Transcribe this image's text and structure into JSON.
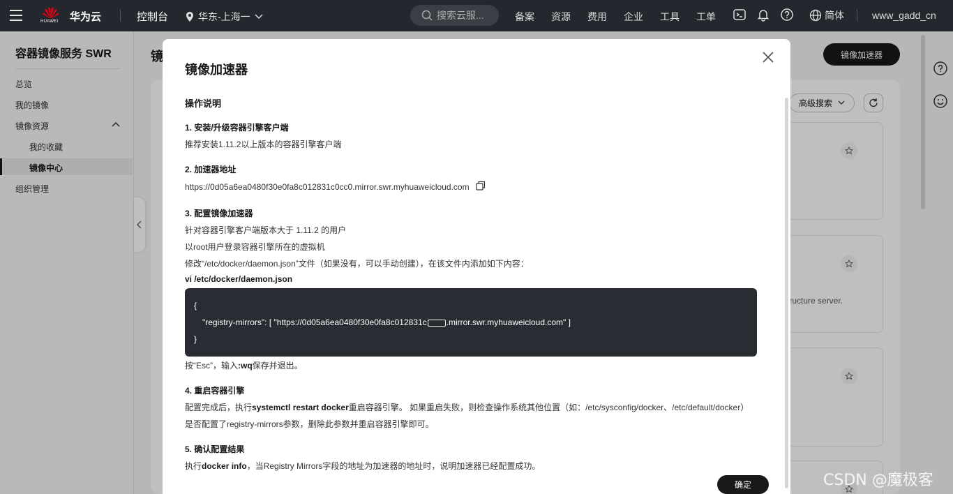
{
  "topbar": {
    "logo_text": "HUAWEI",
    "brand": "华为云",
    "console": "控制台",
    "region": "华东-上海一",
    "search_placeholder": "搜索云服...",
    "links": [
      "备案",
      "资源",
      "费用",
      "企业",
      "工具",
      "工单"
    ],
    "language": "简体",
    "user": "www_gadd_cn"
  },
  "sidebar": {
    "title": "容器镜像服务 SWR",
    "items": [
      {
        "label": "总览"
      },
      {
        "label": "我的镜像"
      },
      {
        "label": "镜像资源"
      },
      {
        "label": "我的收藏"
      },
      {
        "label": "镜像中心"
      },
      {
        "label": "组织管理"
      }
    ]
  },
  "main": {
    "title_partial": "镜",
    "mirror_button": "镜像加速器",
    "advanced_search": "高级搜索",
    "card_desc_partial": "tructure server."
  },
  "modal": {
    "title": "镜像加速器",
    "section_title": "操作说明",
    "step1_title": "1. 安装/升级容器引擎客户端",
    "step1_text": "推荐安装1.11.2以上版本的容器引擎客户端",
    "step2_title": "2. 加速器地址",
    "step2_url": "https://0d05a6ea0480f30e0fa8c012831c0cc0.mirror.swr.myhuaweicloud.com",
    "step3_title": "3. 配置镜像加速器",
    "step3_line1": "针对容器引擎客户端版本大于 1.11.2 的用户",
    "step3_line2": "以root用户登录容器引擎所在的虚拟机",
    "step3_line3": "修改“/etc/docker/daemon.json”文件（如果没有，可以手动创建），在该文件内添加如下内容：",
    "step3_cmd": "vi /etc/docker/daemon.json",
    "code_open": "{",
    "code_body_pre": "\"registry-mirrors\": [ \"https://0d05a6ea0480f30e0fa8c012831c",
    "code_body_post": ".mirror.swr.myhuaweicloud.com\" ]",
    "code_close": "}",
    "step3_after_pre": "按“Esc”，输入",
    "step3_after_cmd": ":wq",
    "step3_after_post": "保存并退出。",
    "step4_title": "4. 重启容器引擎",
    "step4_line1_pre": "配置完成后，执行",
    "step4_line1_cmd": "systemctl restart docker",
    "step4_line1_post": "重启容器引擎。 如果重启失败，则检查操作系统其他位置（如：/etc/sysconfig/docker、/etc/default/docker）",
    "step4_line2": "是否配置了registry-mirrors参数，删除此参数并重启容器引擎即可。",
    "step5_title": "5. 确认配置结果",
    "step5_pre": "执行",
    "step5_cmd": "docker info",
    "step5_post": "，当Registry Mirrors字段的地址为加速器的地址时，说明加速器已经配置成功。",
    "ok_button": "确定"
  },
  "watermark": "CSDN @魔极客"
}
